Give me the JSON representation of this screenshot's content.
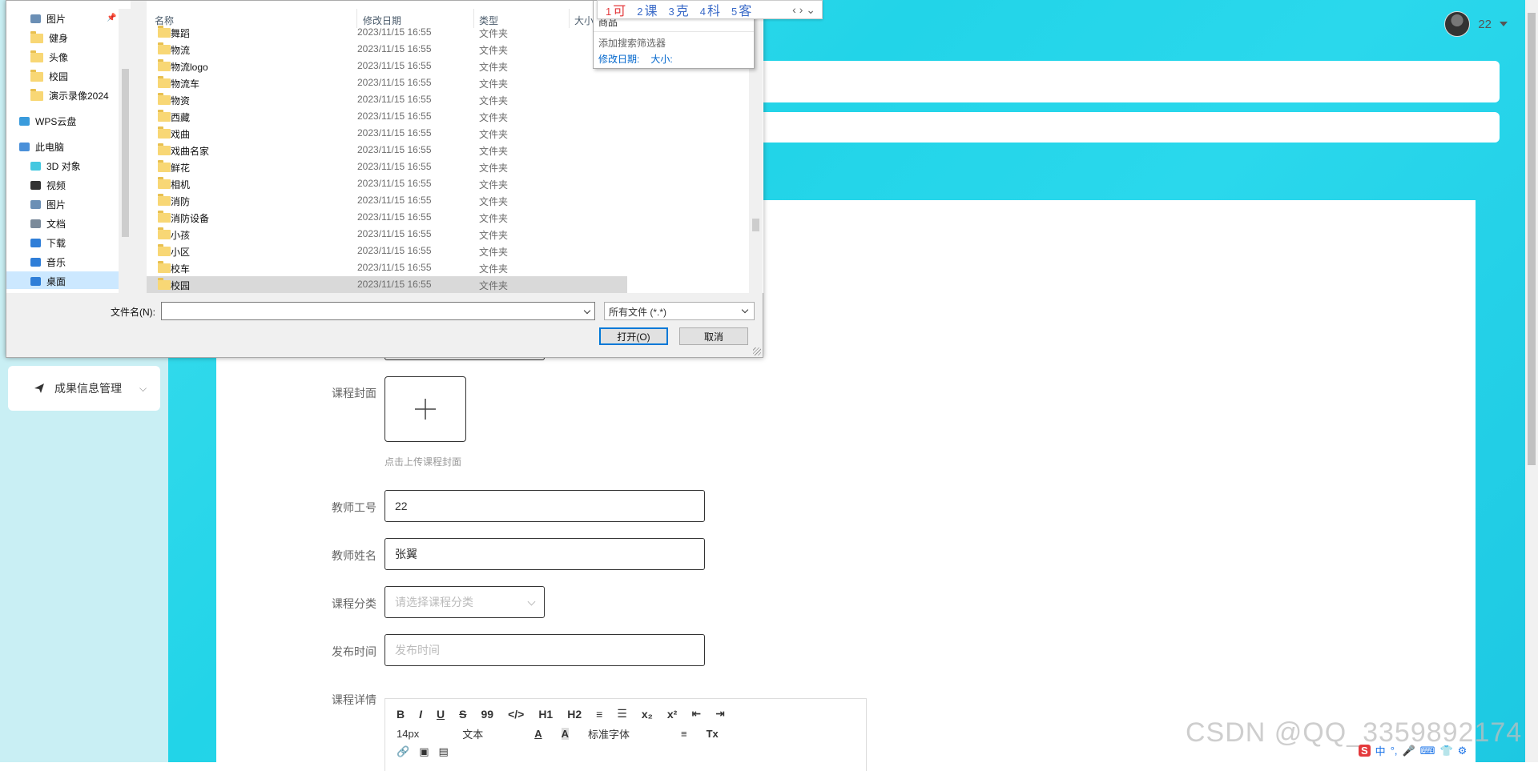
{
  "app": {
    "user_name": "22",
    "side_menu_label": "成果信息管理",
    "form": {
      "cover_label": "课程封面",
      "cover_hint": "点击上传课程封面",
      "teacher_id_label": "教师工号",
      "teacher_id_value": "22",
      "teacher_name_label": "教师姓名",
      "teacher_name_value": "张翼",
      "category_label": "课程分类",
      "category_placeholder": "请选择课程分类",
      "publish_time_label": "发布时间",
      "publish_time_placeholder": "发布时间",
      "detail_label": "课程详情"
    },
    "editor": {
      "row1": [
        "B",
        "I",
        "U",
        "S",
        "99",
        "</>",
        "H1",
        "H2",
        "≡",
        "☰",
        "x₂",
        "x²",
        "⇤",
        "⇥"
      ],
      "font_size": "14px",
      "text_style": "文本",
      "font_family": "标准字体",
      "clear_format": "Tx"
    },
    "watermark": "CSDN @QQ_3359892174"
  },
  "dialog": {
    "nav_items": [
      {
        "label": "图片",
        "type": "pic",
        "level": "child"
      },
      {
        "label": "健身",
        "type": "folder",
        "level": "child"
      },
      {
        "label": "头像",
        "type": "folder",
        "level": "child"
      },
      {
        "label": "校园",
        "type": "folder",
        "level": "child"
      },
      {
        "label": "演示录像2024",
        "type": "folder",
        "level": "child"
      },
      {
        "label": "WPS云盘",
        "type": "cloud",
        "level": "root"
      },
      {
        "label": "此电脑",
        "type": "pc",
        "level": "root"
      },
      {
        "label": "3D 对象",
        "type": "3d",
        "level": "child"
      },
      {
        "label": "视频",
        "type": "video",
        "level": "child"
      },
      {
        "label": "图片",
        "type": "pic",
        "level": "child"
      },
      {
        "label": "文档",
        "type": "doc",
        "level": "child"
      },
      {
        "label": "下载",
        "type": "download",
        "level": "child"
      },
      {
        "label": "音乐",
        "type": "music",
        "level": "child"
      },
      {
        "label": "桌面",
        "type": "desktop",
        "level": "child"
      }
    ],
    "columns": {
      "name": "名称",
      "date": "修改日期",
      "type": "类型",
      "size": "大小"
    },
    "files": [
      {
        "name": "舞蹈",
        "date": "2023/11/15 16:55",
        "type": "文件夹"
      },
      {
        "name": "物流",
        "date": "2023/11/15 16:55",
        "type": "文件夹"
      },
      {
        "name": "物流logo",
        "date": "2023/11/15 16:55",
        "type": "文件夹"
      },
      {
        "name": "物流车",
        "date": "2023/11/15 16:55",
        "type": "文件夹"
      },
      {
        "name": "物资",
        "date": "2023/11/15 16:55",
        "type": "文件夹"
      },
      {
        "name": "西藏",
        "date": "2023/11/15 16:55",
        "type": "文件夹"
      },
      {
        "name": "戏曲",
        "date": "2023/11/15 16:55",
        "type": "文件夹"
      },
      {
        "name": "戏曲名家",
        "date": "2023/11/15 16:55",
        "type": "文件夹"
      },
      {
        "name": "鲜花",
        "date": "2023/11/15 16:55",
        "type": "文件夹"
      },
      {
        "name": "相机",
        "date": "2023/11/15 16:55",
        "type": "文件夹"
      },
      {
        "name": "消防",
        "date": "2023/11/15 16:55",
        "type": "文件夹"
      },
      {
        "name": "消防设备",
        "date": "2023/11/15 16:55",
        "type": "文件夹"
      },
      {
        "name": "小孩",
        "date": "2023/11/15 16:55",
        "type": "文件夹"
      },
      {
        "name": "小区",
        "date": "2023/11/15 16:55",
        "type": "文件夹"
      },
      {
        "name": "校车",
        "date": "2023/11/15 16:55",
        "type": "文件夹"
      },
      {
        "name": "校园",
        "date": "2023/11/15 16:55",
        "type": "文件夹",
        "selected": true
      }
    ],
    "filename_label": "文件名(N):",
    "filename_value": "",
    "filetype_value": "所有文件 (*.*)",
    "open_label": "打开(O)",
    "cancel_label": "取消"
  },
  "search_popup": {
    "query": "商品",
    "add_filter": "添加搜索筛选器",
    "filter_date": "修改日期:",
    "filter_size": "大小:"
  },
  "ime": {
    "candidates": [
      {
        "num": "1",
        "text": "可"
      },
      {
        "num": "2",
        "text": "课"
      },
      {
        "num": "3",
        "text": "克"
      },
      {
        "num": "4",
        "text": "科"
      },
      {
        "num": "5",
        "text": "客"
      }
    ]
  },
  "tray": {
    "ime_mode": "中"
  }
}
